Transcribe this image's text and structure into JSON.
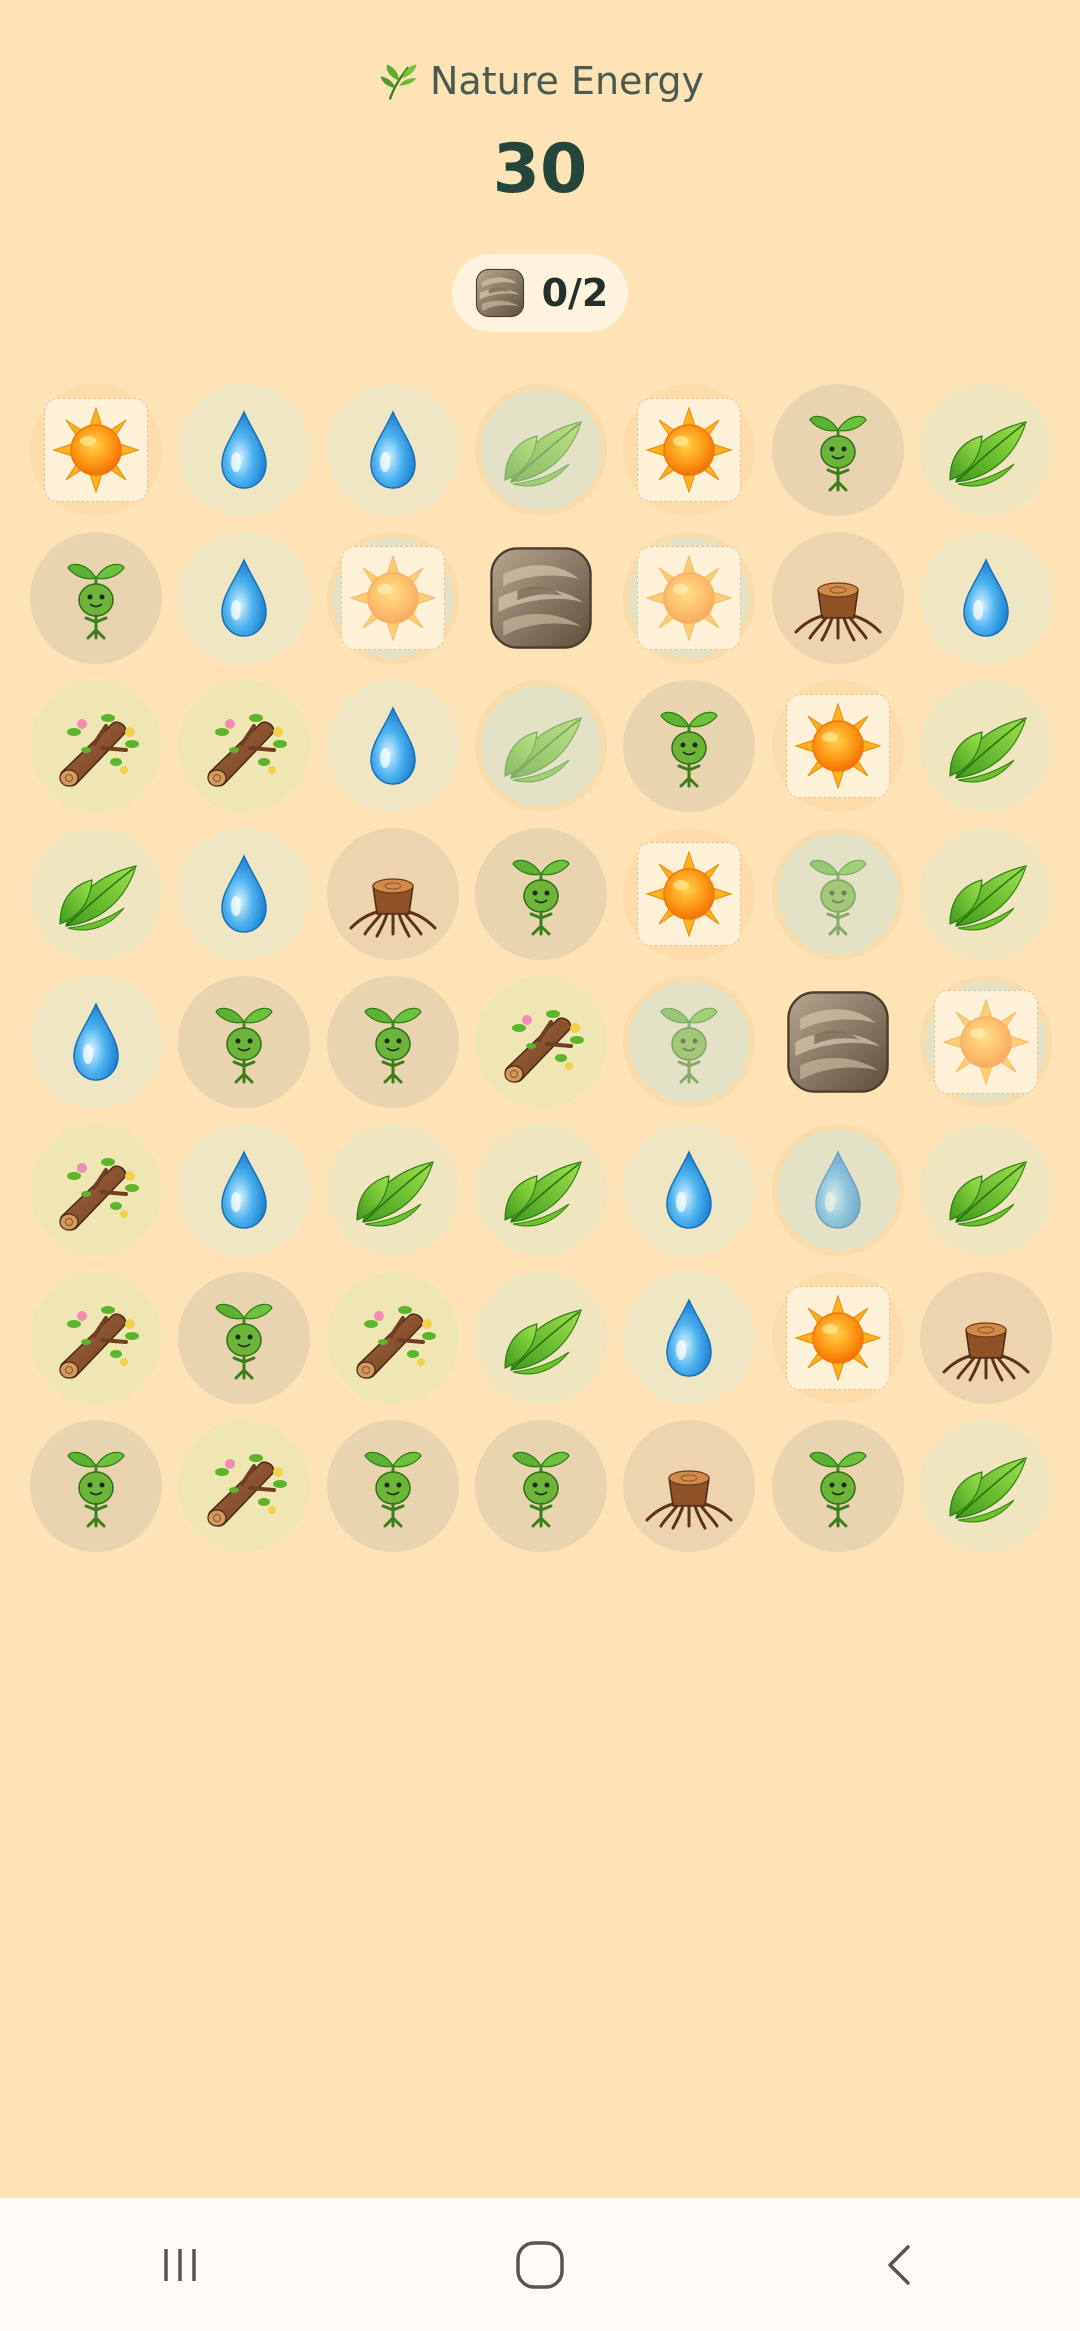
{
  "header": {
    "title": "Nature Energy",
    "title_icon": "leaf-sprig-icon",
    "score": "30"
  },
  "goal": {
    "icon": "rock-icon",
    "progress": "0/2",
    "collected": 0,
    "target": 2
  },
  "board": {
    "rows": 8,
    "cols": 7,
    "tiles": [
      [
        "sun",
        "water",
        "water",
        "leaf-dim",
        "sun",
        "sprout",
        "leaf"
      ],
      [
        "sprout",
        "water",
        "sun-dim",
        "rock",
        "sun-dim",
        "stump",
        "water"
      ],
      [
        "log",
        "log",
        "water",
        "leaf-dim",
        "sprout",
        "sun",
        "leaf"
      ],
      [
        "leaf",
        "water",
        "stump",
        "sprout",
        "sun",
        "sprout-dim",
        "leaf"
      ],
      [
        "water",
        "sprout",
        "sprout",
        "log",
        "sprout-dim",
        "rock",
        "sun-dim"
      ],
      [
        "log",
        "water",
        "leaf",
        "leaf",
        "water",
        "water-dim",
        "leaf"
      ],
      [
        "log",
        "sprout",
        "log",
        "leaf",
        "water",
        "sun",
        "stump"
      ],
      [
        "sprout",
        "log",
        "sprout",
        "sprout",
        "stump",
        "sprout",
        "leaf"
      ]
    ]
  },
  "navbar": {
    "recents": "recents-icon",
    "home": "home-icon",
    "back": "back-icon"
  },
  "colors": {
    "background": "#fde3b5",
    "score": "#24463a",
    "title": "#4a5a4e"
  }
}
